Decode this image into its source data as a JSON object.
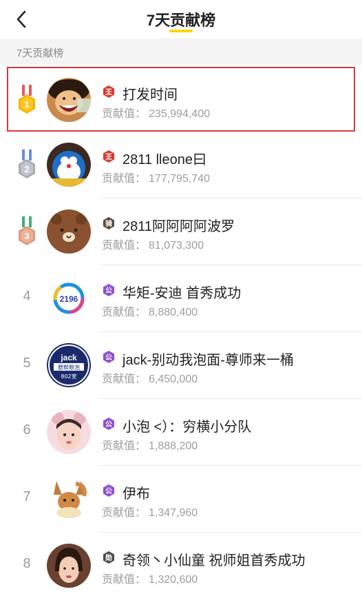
{
  "header": {
    "title": "7天贡献榜",
    "accent_color": "#ffd400"
  },
  "section": {
    "label": "7天贡献榜"
  },
  "contrib_label": "贡献值：",
  "entries": [
    {
      "rank": "1",
      "medal": "gold",
      "badge_char": "王",
      "badge_type": "king",
      "name": "打发时间",
      "value": "235,994,400",
      "highlighted": true
    },
    {
      "rank": "2",
      "medal": "silver",
      "badge_char": "王",
      "badge_type": "king",
      "name": "2811 lleone曰",
      "value": "177,795,740"
    },
    {
      "rank": "3",
      "medal": "bronze",
      "badge_char": "骑",
      "badge_type": "knight",
      "name": "2811阿阿阿阿波罗",
      "value": "81,073,300"
    },
    {
      "rank": "4",
      "badge_char": "公",
      "badge_type": "duke",
      "name": "华矩-安迪  首秀成功",
      "value": "8,880,400"
    },
    {
      "rank": "5",
      "badge_char": "公",
      "badge_type": "duke",
      "name": "jack-别动我泡面-尊师来一桶",
      "value": "6,450,000"
    },
    {
      "rank": "6",
      "badge_char": "公",
      "badge_type": "duke",
      "name": "小泡 <）：穷横小分队",
      "value": "1,888,200"
    },
    {
      "rank": "7",
      "badge_char": "公",
      "badge_type": "duke",
      "name": "伊布",
      "value": "1,347,960"
    },
    {
      "rank": "8",
      "badge_char": "勋",
      "badge_type": "noble",
      "name": "奇领丶小仙童 祝师姐首秀成功",
      "value": "1,320,600"
    }
  ],
  "avatar_texts": {
    "row4": "2196",
    "row5_top": "jack",
    "row5_mid": "腮帮眼泡",
    "row5_bot": "802室"
  },
  "colors": {
    "king_badge": "#d83a2e",
    "duke_badge": "#8e4fd6",
    "knight_badge": "#5b4a40",
    "noble_badge": "#4a4a4a",
    "highlight_border": "#d9383a"
  }
}
